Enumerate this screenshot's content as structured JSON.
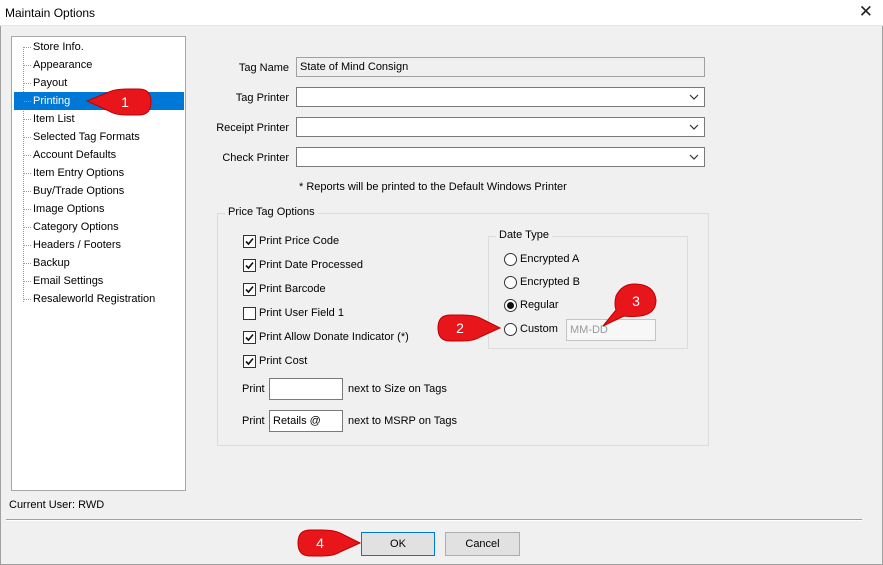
{
  "window": {
    "title": "Maintain Options",
    "close_glyph": "✕"
  },
  "sidebar": {
    "items": [
      {
        "label": "Store Info."
      },
      {
        "label": "Appearance"
      },
      {
        "label": "Payout"
      },
      {
        "label": "Printing",
        "selected": true
      },
      {
        "label": "Item List"
      },
      {
        "label": "Selected Tag Formats"
      },
      {
        "label": "Account Defaults"
      },
      {
        "label": "Item Entry Options"
      },
      {
        "label": "Buy/Trade Options"
      },
      {
        "label": "Image Options"
      },
      {
        "label": "Category Options"
      },
      {
        "label": "Headers / Footers"
      },
      {
        "label": "Backup"
      },
      {
        "label": "Email Settings"
      },
      {
        "label": "Resaleworld Registration"
      }
    ]
  },
  "printing": {
    "tag_name_label": "Tag Name",
    "tag_name_value": "State of Mind Consign",
    "tag_printer_label": "Tag Printer",
    "tag_printer_value": "",
    "receipt_printer_label": "Receipt Printer",
    "receipt_printer_value": "",
    "check_printer_label": "Check Printer",
    "check_printer_value": "",
    "note": "* Reports will be printed to the Default Windows Printer"
  },
  "price_tag_options": {
    "title": "Price Tag Options",
    "checks": [
      {
        "label": "Print Price Code",
        "checked": true
      },
      {
        "label": "Print Date Processed",
        "checked": true
      },
      {
        "label": "Print Barcode",
        "checked": true
      },
      {
        "label": "Print User Field 1",
        "checked": false
      },
      {
        "label": "Print Allow Donate Indicator (*)",
        "checked": true
      },
      {
        "label": "Print Cost",
        "checked": true
      }
    ],
    "print_size": {
      "prefix": "Print",
      "value": "",
      "suffix": "next to Size on Tags"
    },
    "print_msrp": {
      "prefix": "Print",
      "value": "Retails @",
      "suffix": "next to MSRP on Tags"
    },
    "date_type": {
      "title": "Date Type",
      "options": [
        {
          "label": "Encrypted A",
          "selected": false
        },
        {
          "label": "Encrypted B",
          "selected": false
        },
        {
          "label": "Regular",
          "selected": true
        },
        {
          "label": "Custom",
          "selected": false
        }
      ],
      "custom_placeholder": "MM-DD"
    }
  },
  "footer": {
    "current_user": "Current User: RWD",
    "ok_label": "OK",
    "cancel_label": "Cancel"
  },
  "callouts": [
    {
      "number": "1"
    },
    {
      "number": "2"
    },
    {
      "number": "3"
    },
    {
      "number": "4"
    }
  ],
  "colors": {
    "selection": "#0078d7",
    "callout": "#e8161a"
  }
}
